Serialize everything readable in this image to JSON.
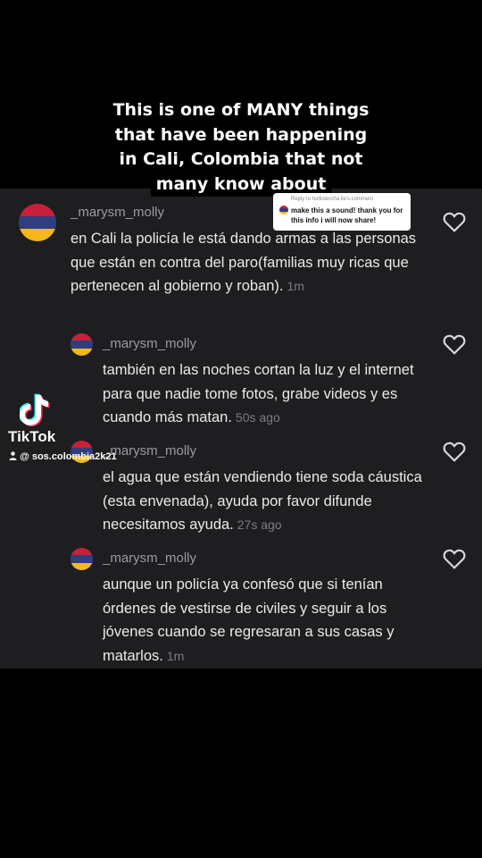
{
  "caption": {
    "line1": "This is one of MANY things",
    "line2": "that have been happening",
    "line3": "in Cali, Colombia that not",
    "line4": "many know about"
  },
  "reply_card": {
    "title": "Reply to hollistercha lie's comment",
    "text": "make this a sound! thank you for this info i will now share!"
  },
  "comments": [
    {
      "username": "_marysm_molly",
      "text": "en Cali la policía le está dando armas a las personas que están en contra del paro(familias muy ricas que pertenecen al gobierno y roban).",
      "time": "1m"
    },
    {
      "username": "_marysm_molly",
      "text": "también en las noches cortan la luz y el internet para que nadie tome fotos, grabe videos y es cuando más matan.",
      "time": "50s ago"
    },
    {
      "username": "_marysm_molly",
      "text": "el agua que están vendiendo tiene soda cáustica (esta envenada), ayuda por favor difunde necesitamos ayuda.",
      "time": "27s ago"
    },
    {
      "username": "_marysm_molly",
      "text": "aunque un policía ya confesó que si tenían órdenes de vestirse de civiles y seguir a los jóvenes cuando se regresaran a sus casas y matarlos.",
      "time": "1m"
    }
  ],
  "watermark": {
    "brand": "TikTok",
    "user": "@ sos.colombia2k21"
  },
  "colors": {
    "panel": "#1e1e21",
    "flag_red": "#c8203a",
    "flag_blue": "#2f3e7e",
    "flag_yellow": "#f2b81c"
  },
  "icons": {
    "like": "heart-icon",
    "logo": "tiktok-logo-icon",
    "user": "person-icon"
  }
}
